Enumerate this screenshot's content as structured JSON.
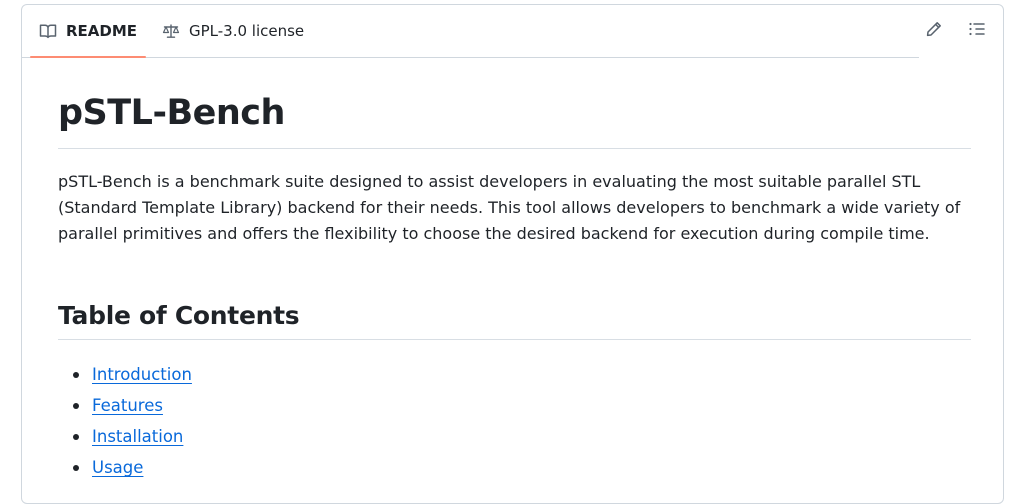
{
  "tabs": {
    "readme": {
      "label": "README",
      "icon": "book-icon",
      "active": true
    },
    "license": {
      "label": "GPL-3.0 license",
      "icon": "law-scale-icon"
    }
  },
  "toolbar": {
    "edit_icon": "pencil-icon",
    "outline_icon": "list-outline-icon"
  },
  "readme": {
    "title": "pSTL-Bench",
    "intro": "pSTL-Bench is a benchmark suite designed to assist developers in evaluating the most suitable parallel STL (Standard Template Library) backend for their needs. This tool allows developers to benchmark a wide variety of parallel primitives and offers the flexibility to choose the desired backend for execution during compile time.",
    "toc_heading": "Table of Contents",
    "toc": [
      {
        "label": "Introduction"
      },
      {
        "label": "Features"
      },
      {
        "label": "Installation"
      },
      {
        "label": "Usage"
      }
    ]
  },
  "colors": {
    "link": "#0969da",
    "active_tab_underline": "#fd8c73",
    "border": "#d0d7de",
    "text": "#1f2328"
  }
}
